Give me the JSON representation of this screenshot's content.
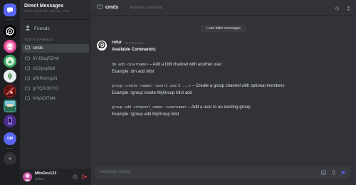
{
  "sidebar": {
    "title": "Direct Messages",
    "subtitle": "mist-roturdm.server.com",
    "friends_label": "Friends",
    "section_label": "TEXT CHANNELS",
    "channels": [
      {
        "name": "cmds"
      },
      {
        "name": "9YJBqqRZmh"
      },
      {
        "name": "A22lpsy8e8"
      },
      {
        "name": "aRrRhvhgzN"
      },
      {
        "name": "qrTQSr3KYO"
      },
      {
        "name": "hHybDf7M4"
      }
    ]
  },
  "rail": {
    "dm_label": "DM",
    "add_label": "+"
  },
  "user": {
    "name": "MiloDev123",
    "status": "Online"
  },
  "header": {
    "channel": "cmds",
    "description": "Available commands"
  },
  "chat": {
    "load_older": "Load older messages",
    "message": {
      "author": "rotur",
      "time": "19 Oct 15:00",
      "heading": "Available Commands:",
      "commands": [
        {
          "code": "dm add <username>",
          "desc": " – Add a DM channel with another user",
          "example": "Example: dm add Mist"
        },
        {
          "code": "group create <name> <user1 user2 ...>",
          "desc": " – Create a group channel with optional members",
          "example": "Example: /group create MyGroup Mist add"
        },
        {
          "code": "group add <channel_name> <username>",
          "desc": " – Add a user to an existing group",
          "example": "Example: /group add MyGroup Mist"
        }
      ]
    }
  },
  "composer": {
    "placeholder": "Message #cmds"
  },
  "colors": {
    "accent": "#5865f2",
    "bg": "#313338",
    "sidebar": "#2b2d31",
    "rail": "#1e1f22",
    "logout": "#f23f42"
  }
}
